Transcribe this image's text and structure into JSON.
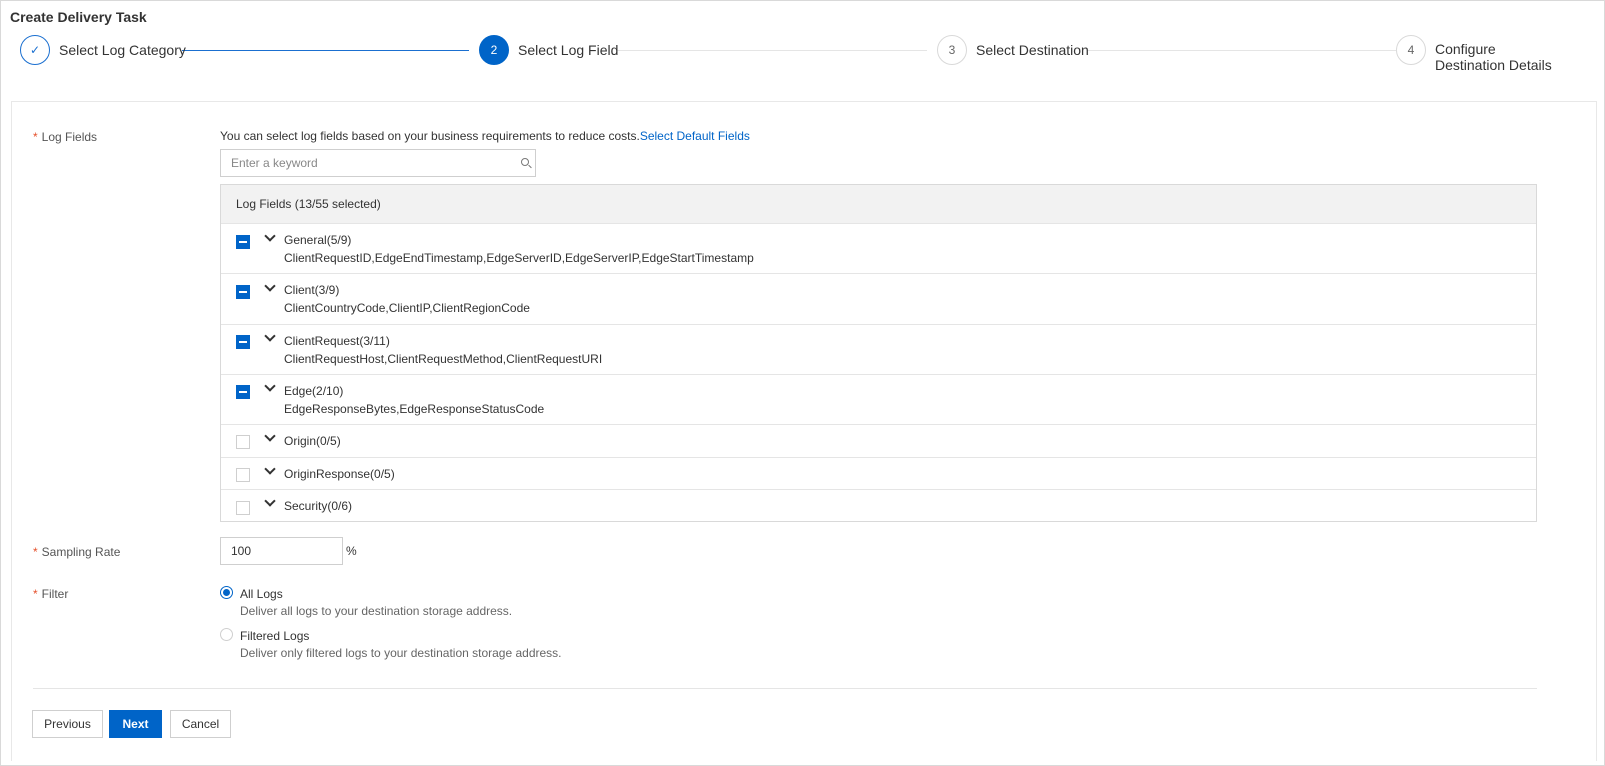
{
  "page": {
    "title": "Create Delivery Task"
  },
  "steps": [
    {
      "number": "✓",
      "label": "Select Log Category",
      "state": "done"
    },
    {
      "number": "2",
      "label": "Select Log Field",
      "state": "active"
    },
    {
      "number": "3",
      "label": "Select Destination",
      "state": "pending"
    },
    {
      "number": "4",
      "label_line1": "Configure",
      "label_line2": "Destination Details",
      "state": "pending"
    }
  ],
  "log_fields": {
    "label": "Log Fields",
    "required_mark": "*",
    "hint": "You can select log fields based on your business requirements to reduce costs.",
    "hint_link": "Select Default Fields",
    "search_placeholder": "Enter a keyword",
    "search_icon": "search-icon",
    "table_header": "Log Fields (13/55 selected)",
    "groups": [
      {
        "name": "General(5/9)",
        "fields": "ClientRequestID,EdgeEndTimestamp,EdgeServerID,EdgeServerIP,EdgeStartTimestamp",
        "checked": "partial"
      },
      {
        "name": "Client(3/9)",
        "fields": "ClientCountryCode,ClientIP,ClientRegionCode",
        "checked": "partial"
      },
      {
        "name": "ClientRequest(3/11)",
        "fields": "ClientRequestHost,ClientRequestMethod,ClientRequestURI",
        "checked": "partial"
      },
      {
        "name": "Edge(2/10)",
        "fields": "EdgeResponseBytes,EdgeResponseStatusCode",
        "checked": "partial"
      },
      {
        "name": "Origin(0/5)",
        "fields": "",
        "checked": "none"
      },
      {
        "name": "OriginResponse(0/5)",
        "fields": "",
        "checked": "none"
      },
      {
        "name": "Security(0/6)",
        "fields": "",
        "checked": "none"
      }
    ]
  },
  "sampling": {
    "label": "Sampling Rate",
    "required_mark": "*",
    "value": "100",
    "unit": "%"
  },
  "filter": {
    "label": "Filter",
    "required_mark": "*",
    "options": [
      {
        "label": "All Logs",
        "description": "Deliver all logs to your destination storage address.",
        "selected": true
      },
      {
        "label": "Filtered Logs",
        "description": "Deliver only filtered logs to your destination storage address.",
        "selected": false
      }
    ]
  },
  "buttons": {
    "previous": "Previous",
    "next": "Next",
    "cancel": "Cancel"
  },
  "colors": {
    "primary": "#0064c8",
    "required": "#e5502b",
    "border": "#d9d9d9",
    "table_header_bg": "#f2f2f2"
  }
}
